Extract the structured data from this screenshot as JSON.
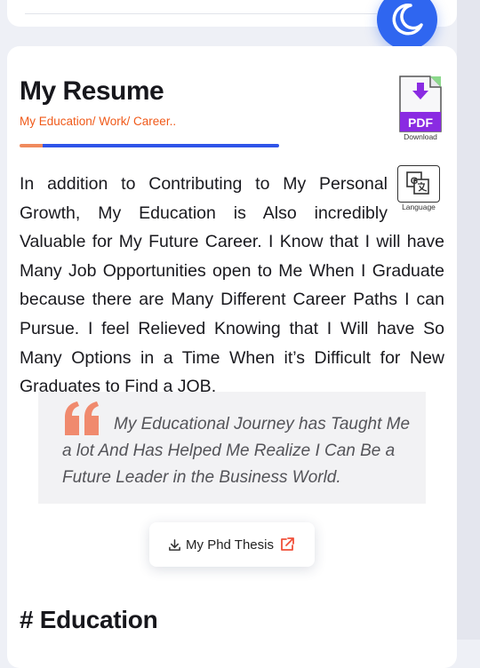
{
  "resume": {
    "title": "My Resume",
    "subtitle": "My Education/ Work/ Career..",
    "download": {
      "badge": "PDF",
      "caption": "Download",
      "icon": "pdf-download-icon"
    },
    "language": {
      "caption": "Language",
      "icon": "translate-icon"
    },
    "paragraph": "In addition to Contributing to My Personal Growth, My Education is Also incredibly Valuable for My Future Career. I Know that I will have Many Job Opportunities open to Me When I Graduate because there are Many Different Career Paths I can Pursue. I feel Relieved Knowing that I Will have So Many Options in a Time When it’s Difficult for New Graduates to Find a JOB.",
    "quote": "My Educational Journey has Taught Me a lot And Has Helped Me Realize I Can Be a Future Leader in the Business World.",
    "thesis_button": {
      "label": "My Phd Thesis",
      "icon_left": "download-icon",
      "icon_right": "external-link-icon"
    }
  },
  "education": {
    "heading": "# Education"
  },
  "theme_toggle": {
    "icon": "moon-icon"
  },
  "colors": {
    "accent_orange": "#f05a1a",
    "accent_blue": "#2f54e8",
    "toggle_blue": "#2f66f0",
    "pdf_purple": "#8a2be2",
    "quote_coral": "#f08a6e"
  }
}
